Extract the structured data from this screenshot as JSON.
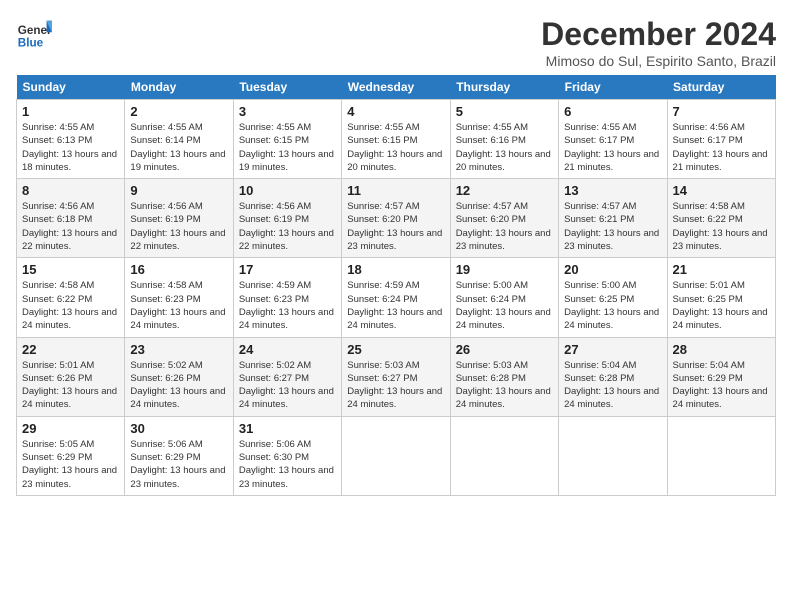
{
  "logo": {
    "line1": "General",
    "line2": "Blue"
  },
  "title": "December 2024",
  "subtitle": "Mimoso do Sul, Espirito Santo, Brazil",
  "days_of_week": [
    "Sunday",
    "Monday",
    "Tuesday",
    "Wednesday",
    "Thursday",
    "Friday",
    "Saturday"
  ],
  "weeks": [
    [
      {
        "day": 1,
        "sunrise": "4:55 AM",
        "sunset": "6:13 PM",
        "daylight": "13 hours and 18 minutes."
      },
      {
        "day": 2,
        "sunrise": "4:55 AM",
        "sunset": "6:14 PM",
        "daylight": "13 hours and 19 minutes."
      },
      {
        "day": 3,
        "sunrise": "4:55 AM",
        "sunset": "6:15 PM",
        "daylight": "13 hours and 19 minutes."
      },
      {
        "day": 4,
        "sunrise": "4:55 AM",
        "sunset": "6:15 PM",
        "daylight": "13 hours and 20 minutes."
      },
      {
        "day": 5,
        "sunrise": "4:55 AM",
        "sunset": "6:16 PM",
        "daylight": "13 hours and 20 minutes."
      },
      {
        "day": 6,
        "sunrise": "4:55 AM",
        "sunset": "6:17 PM",
        "daylight": "13 hours and 21 minutes."
      },
      {
        "day": 7,
        "sunrise": "4:56 AM",
        "sunset": "6:17 PM",
        "daylight": "13 hours and 21 minutes."
      }
    ],
    [
      {
        "day": 8,
        "sunrise": "4:56 AM",
        "sunset": "6:18 PM",
        "daylight": "13 hours and 22 minutes."
      },
      {
        "day": 9,
        "sunrise": "4:56 AM",
        "sunset": "6:19 PM",
        "daylight": "13 hours and 22 minutes."
      },
      {
        "day": 10,
        "sunrise": "4:56 AM",
        "sunset": "6:19 PM",
        "daylight": "13 hours and 22 minutes."
      },
      {
        "day": 11,
        "sunrise": "4:57 AM",
        "sunset": "6:20 PM",
        "daylight": "13 hours and 23 minutes."
      },
      {
        "day": 12,
        "sunrise": "4:57 AM",
        "sunset": "6:20 PM",
        "daylight": "13 hours and 23 minutes."
      },
      {
        "day": 13,
        "sunrise": "4:57 AM",
        "sunset": "6:21 PM",
        "daylight": "13 hours and 23 minutes."
      },
      {
        "day": 14,
        "sunrise": "4:58 AM",
        "sunset": "6:22 PM",
        "daylight": "13 hours and 23 minutes."
      }
    ],
    [
      {
        "day": 15,
        "sunrise": "4:58 AM",
        "sunset": "6:22 PM",
        "daylight": "13 hours and 24 minutes."
      },
      {
        "day": 16,
        "sunrise": "4:58 AM",
        "sunset": "6:23 PM",
        "daylight": "13 hours and 24 minutes."
      },
      {
        "day": 17,
        "sunrise": "4:59 AM",
        "sunset": "6:23 PM",
        "daylight": "13 hours and 24 minutes."
      },
      {
        "day": 18,
        "sunrise": "4:59 AM",
        "sunset": "6:24 PM",
        "daylight": "13 hours and 24 minutes."
      },
      {
        "day": 19,
        "sunrise": "5:00 AM",
        "sunset": "6:24 PM",
        "daylight": "13 hours and 24 minutes."
      },
      {
        "day": 20,
        "sunrise": "5:00 AM",
        "sunset": "6:25 PM",
        "daylight": "13 hours and 24 minutes."
      },
      {
        "day": 21,
        "sunrise": "5:01 AM",
        "sunset": "6:25 PM",
        "daylight": "13 hours and 24 minutes."
      }
    ],
    [
      {
        "day": 22,
        "sunrise": "5:01 AM",
        "sunset": "6:26 PM",
        "daylight": "13 hours and 24 minutes."
      },
      {
        "day": 23,
        "sunrise": "5:02 AM",
        "sunset": "6:26 PM",
        "daylight": "13 hours and 24 minutes."
      },
      {
        "day": 24,
        "sunrise": "5:02 AM",
        "sunset": "6:27 PM",
        "daylight": "13 hours and 24 minutes."
      },
      {
        "day": 25,
        "sunrise": "5:03 AM",
        "sunset": "6:27 PM",
        "daylight": "13 hours and 24 minutes."
      },
      {
        "day": 26,
        "sunrise": "5:03 AM",
        "sunset": "6:28 PM",
        "daylight": "13 hours and 24 minutes."
      },
      {
        "day": 27,
        "sunrise": "5:04 AM",
        "sunset": "6:28 PM",
        "daylight": "13 hours and 24 minutes."
      },
      {
        "day": 28,
        "sunrise": "5:04 AM",
        "sunset": "6:29 PM",
        "daylight": "13 hours and 24 minutes."
      }
    ],
    [
      {
        "day": 29,
        "sunrise": "5:05 AM",
        "sunset": "6:29 PM",
        "daylight": "13 hours and 23 minutes."
      },
      {
        "day": 30,
        "sunrise": "5:06 AM",
        "sunset": "6:29 PM",
        "daylight": "13 hours and 23 minutes."
      },
      {
        "day": 31,
        "sunrise": "5:06 AM",
        "sunset": "6:30 PM",
        "daylight": "13 hours and 23 minutes."
      },
      null,
      null,
      null,
      null
    ]
  ]
}
